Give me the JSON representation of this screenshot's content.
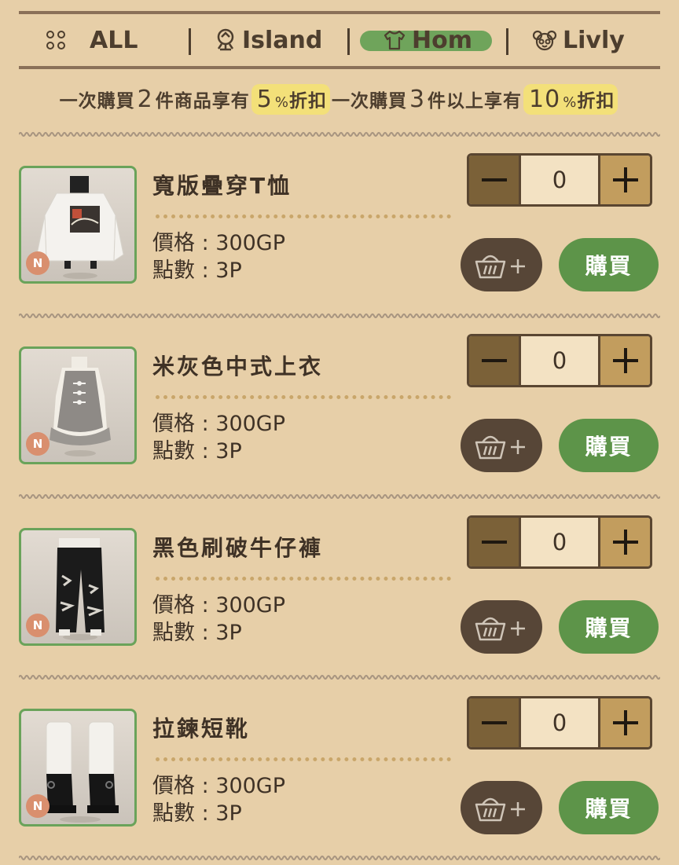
{
  "tabs": [
    {
      "label": "ALL",
      "icon": "grid-dots-icon"
    },
    {
      "label": "Island",
      "icon": "island-tree-icon"
    },
    {
      "label": "Hom",
      "icon": "shirt-icon",
      "active": true
    },
    {
      "label": "Livly",
      "icon": "livly-face-icon"
    }
  ],
  "promo": {
    "part1": "一次購買",
    "n1": "2",
    "part2": "件商品享有",
    "disc1": "5",
    "pct": "%",
    "off": "折扣",
    "part3": "一次購買",
    "n2": "3",
    "part4": "件以上享有",
    "disc2": "10"
  },
  "items": [
    {
      "name": "寬版疊穿T恤",
      "price": "價格 : 300GP",
      "points": "點數 :  3P",
      "qty": "0",
      "rarity": "N",
      "buy": "購買"
    },
    {
      "name": "米灰色中式上衣",
      "price": "價格 : 300GP",
      "points": "點數 :  3P",
      "qty": "0",
      "rarity": "N",
      "buy": "購買"
    },
    {
      "name": "黑色刷破牛仔褲",
      "price": "價格 : 300GP",
      "points": "點數 :  3P",
      "qty": "0",
      "rarity": "N",
      "buy": "購買"
    },
    {
      "name": "拉鍊短靴",
      "price": "價格 : 300GP",
      "points": "點數 :  3P",
      "qty": "0",
      "rarity": "N",
      "buy": "購買"
    }
  ],
  "colors": {
    "background": "#e7cfa8",
    "buy_button": "#5d9449",
    "active_tab_highlight": "#6fa45b",
    "promo_highlight": "#f3e079"
  }
}
